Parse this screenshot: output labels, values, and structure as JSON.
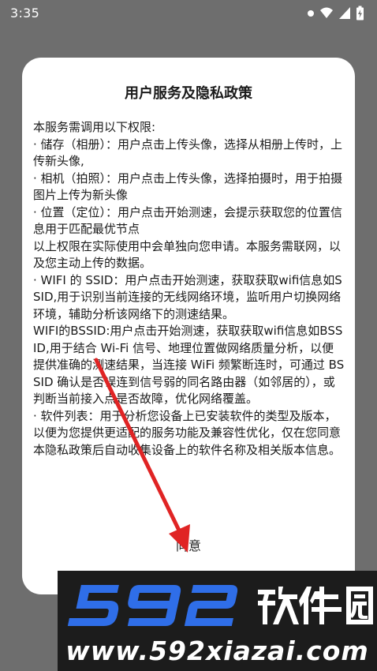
{
  "status_bar": {
    "time": "3:35",
    "icons": [
      "notification-dot-icon",
      "wifi-icon",
      "cellular-signal-icon",
      "battery-charging-icon"
    ]
  },
  "dialog": {
    "title": "用户服务及隐私政策",
    "paragraphs": [
      "本服务需调用以下权限:",
      "· 储存（相册）：用户点击上传头像，选择从相册上传时，上传新头像,",
      "· 相机（拍照）：用户点击上传头像，选择拍摄时，用于拍摄图片上传为新头像",
      "· 位置（定位）：用户点击开始测速，会提示获取您的位置信息用于匹配最优节点",
      "以上权限在实际使用中会单独向您申请。本服务需联网，以及您主动上传的数据。",
      "· WIFI 的 SSID：用户点击开始测速，获取获取wifi信息如SSID,用于识别当前连接的无线网络环境，监听用户切换网络环境，辅助分析该网络下的测速结果。",
      "WIFI的BSSID:用户点击开始测速，获取获取wifi信息如BSSID,用于结合 Wi-Fi 信号、地理位置做网络质量分析，以便提供准确的测速结果，当连接 WiFi 频繁断连时，可通过 BSSID 确认是否误连到信号弱的同名路由器（如邻居的），或判断当前接入点是否故障，优化网络覆盖。",
      "· 软件列表：用于分析您设备上已安装软件的类型及版本，以便为您提供更适配的服务功能及兼容性优化，仅在您同意本隐私政策后自动收集设备上的软件名称及相关版本信息。"
    ],
    "agree_label": "同意"
  },
  "watermark": {
    "logo_text": "592软件园",
    "url": "www.592xiazai.com",
    "logo_color": "#2f6ee8"
  },
  "overlay": {
    "arrow_color": "#e02424"
  }
}
